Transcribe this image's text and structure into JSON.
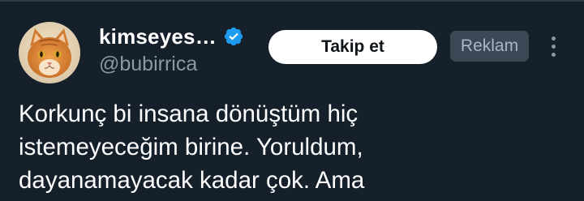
{
  "tweet": {
    "display_name": "kimseyes…",
    "verified": true,
    "handle": "@bubirrica",
    "follow_label": "Takip et",
    "ad_label": "Reklam",
    "text_lines": [
      "Korkunç bi insana dönüştüm hiç",
      "istemeyeceğim birine. Yoruldum,",
      "dayanamayacak kadar çok. Ama"
    ]
  },
  "colors": {
    "background": "#15202b",
    "verified_badge": "#1d9bf0",
    "secondary_text": "#8b98a5"
  },
  "icons": {
    "avatar": "orange-cat-avatar",
    "verified": "verified-badge-icon",
    "more": "more-options-icon"
  }
}
